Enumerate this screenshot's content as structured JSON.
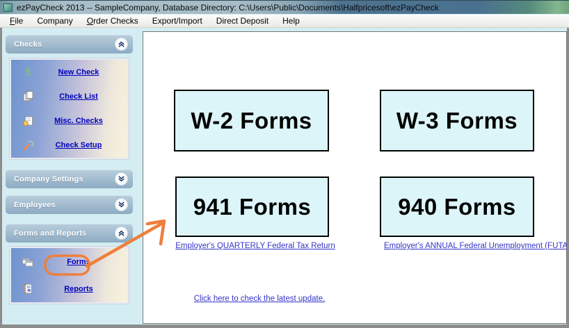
{
  "window": {
    "title": "ezPayCheck 2013 -- SampleCompany, Database Directory: C:\\Users\\Public\\Documents\\Halfpricesoft\\ezPayCheck"
  },
  "menu": {
    "items": [
      {
        "key": "F",
        "rest": "ile"
      },
      {
        "key": "",
        "rest": "Company"
      },
      {
        "key": "O",
        "rest": "rder Checks"
      },
      {
        "key": "",
        "rest": "Export/Import"
      },
      {
        "key": "",
        "rest": "Direct Deposit"
      },
      {
        "key": "",
        "rest": "Help"
      }
    ]
  },
  "sidebar": {
    "sections": [
      {
        "title": "Checks",
        "state": "expanded",
        "items": [
          {
            "icon": "dollar-icon",
            "label": "New Check"
          },
          {
            "icon": "copy-icon",
            "label": "Check List"
          },
          {
            "icon": "misc-checks-icon",
            "label": "Misc. Checks"
          },
          {
            "icon": "wrench-icon",
            "label": "Check Setup"
          }
        ]
      },
      {
        "title": "Company Settings",
        "state": "collapsed"
      },
      {
        "title": "Employees",
        "state": "collapsed"
      },
      {
        "title": "Forms and Reports",
        "state": "expanded",
        "items": [
          {
            "icon": "forms-icon",
            "label": "Forms",
            "highlighted": true
          },
          {
            "icon": "reports-icon",
            "label": "Reports"
          }
        ]
      }
    ]
  },
  "main": {
    "form_buttons": [
      "W-2 Forms",
      "W-3 Forms",
      "941 Forms",
      "940 Forms"
    ],
    "form_links": [
      "Employer's QUARTERLY Federal Tax Return",
      "Employer's ANNUAL Federal Unemployment (FUTA)"
    ],
    "update_link": "Click here to check the latest update."
  },
  "annotation": {
    "highlight_target": "Forms",
    "color": "#EE7F3B"
  }
}
